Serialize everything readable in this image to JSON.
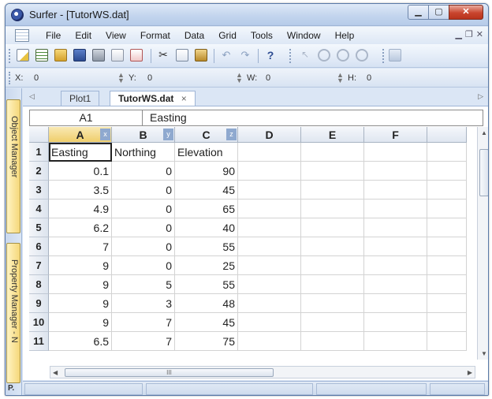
{
  "window": {
    "title": "Surfer - [TutorWS.dat]"
  },
  "menu": [
    "File",
    "Edit",
    "View",
    "Format",
    "Data",
    "Grid",
    "Tools",
    "Window",
    "Help"
  ],
  "coords": {
    "x_label": "X:",
    "x_value": "0",
    "y_label": "Y:",
    "y_value": "0",
    "w_label": "W:",
    "w_value": "0",
    "h_label": "H:",
    "h_value": "0"
  },
  "dock": {
    "object_manager": "Object Manager",
    "property_manager": "Property Manager - N",
    "bottom_label": "P."
  },
  "tabs": {
    "plot": "Plot1",
    "worksheet": "TutorWS.dat",
    "close_glyph": "×"
  },
  "cellbar": {
    "ref": "A1",
    "content": "Easting"
  },
  "columns": [
    {
      "label": "A",
      "tag": "x"
    },
    {
      "label": "B",
      "tag": "y"
    },
    {
      "label": "C",
      "tag": "z"
    },
    {
      "label": "D",
      "tag": ""
    },
    {
      "label": "E",
      "tag": ""
    },
    {
      "label": "F",
      "tag": ""
    }
  ],
  "rows": [
    {
      "n": "1",
      "a": "Easting",
      "b": "Northing",
      "c": "Elevation"
    },
    {
      "n": "2",
      "a": "0.1",
      "b": "0",
      "c": "90"
    },
    {
      "n": "3",
      "a": "3.5",
      "b": "0",
      "c": "45"
    },
    {
      "n": "4",
      "a": "4.9",
      "b": "0",
      "c": "65"
    },
    {
      "n": "5",
      "a": "6.2",
      "b": "0",
      "c": "40"
    },
    {
      "n": "6",
      "a": "7",
      "b": "0",
      "c": "55"
    },
    {
      "n": "7",
      "a": "9",
      "b": "0",
      "c": "25"
    },
    {
      "n": "8",
      "a": "9",
      "b": "5",
      "c": "55"
    },
    {
      "n": "9",
      "a": "9",
      "b": "3",
      "c": "48"
    },
    {
      "n": "10",
      "a": "9",
      "b": "7",
      "c": "45"
    },
    {
      "n": "11",
      "a": "6.5",
      "b": "7",
      "c": "75"
    }
  ],
  "hscroll_thumb": "III"
}
